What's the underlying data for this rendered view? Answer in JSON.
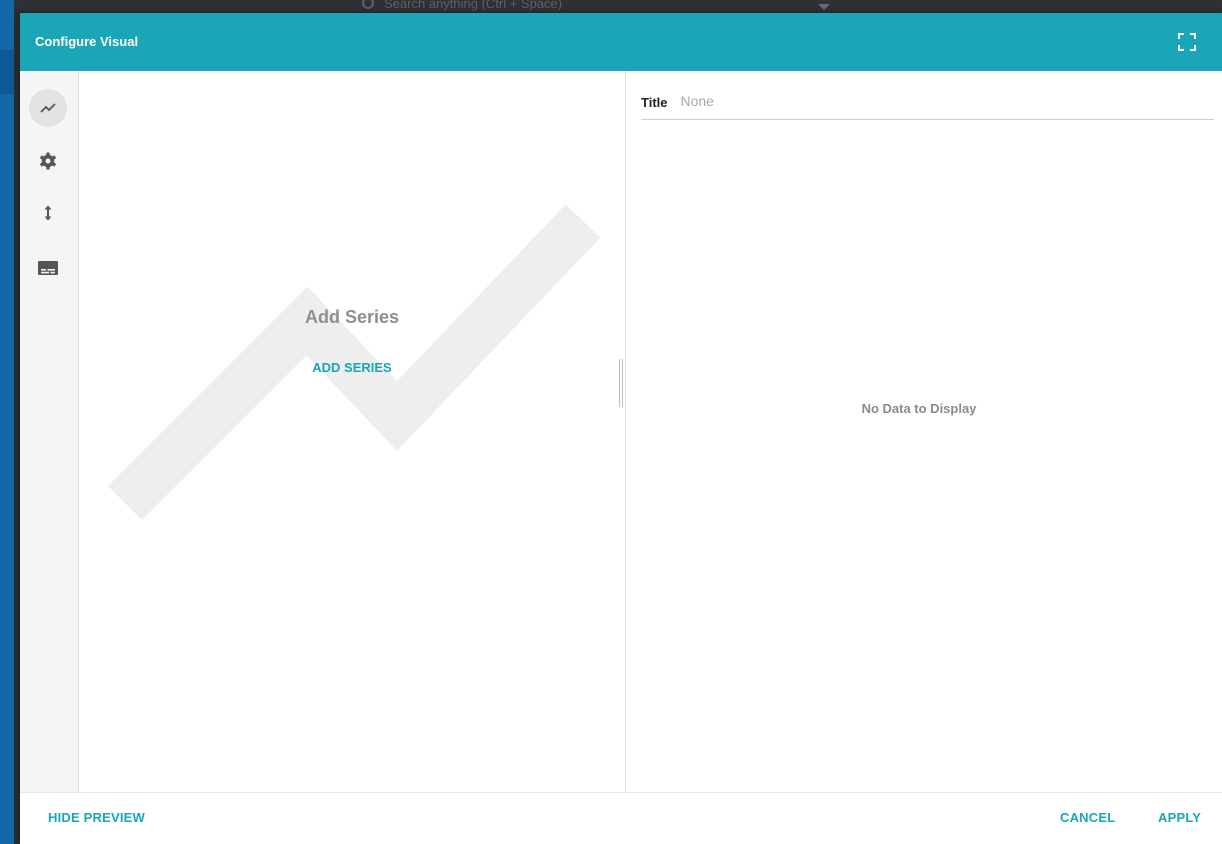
{
  "background_app": {
    "search_placeholder": "Search anything (Ctrl + Space)"
  },
  "modal": {
    "title": "Configure Visual",
    "expand_icon": "fullscreen-icon"
  },
  "rail": {
    "items": [
      {
        "name": "series",
        "icon": "line-chart-icon",
        "active": true
      },
      {
        "name": "settings",
        "icon": "gear-icon",
        "active": false
      },
      {
        "name": "axis",
        "icon": "vertical-arrows-icon",
        "active": false
      },
      {
        "name": "legend",
        "icon": "subtitles-icon",
        "active": false
      }
    ]
  },
  "series_panel": {
    "heading": "Add Series",
    "add_link": "ADD SERIES"
  },
  "preview": {
    "title_label": "Title",
    "title_placeholder": "None",
    "title_value": "",
    "empty_message": "No Data to Display"
  },
  "footer": {
    "hide_preview": "HIDE PREVIEW",
    "cancel": "CANCEL",
    "apply": "APPLY"
  },
  "colors": {
    "accent": "#1aa6b7",
    "rail_bg": "#f5f5f5",
    "watermark": "#eeeeee"
  }
}
